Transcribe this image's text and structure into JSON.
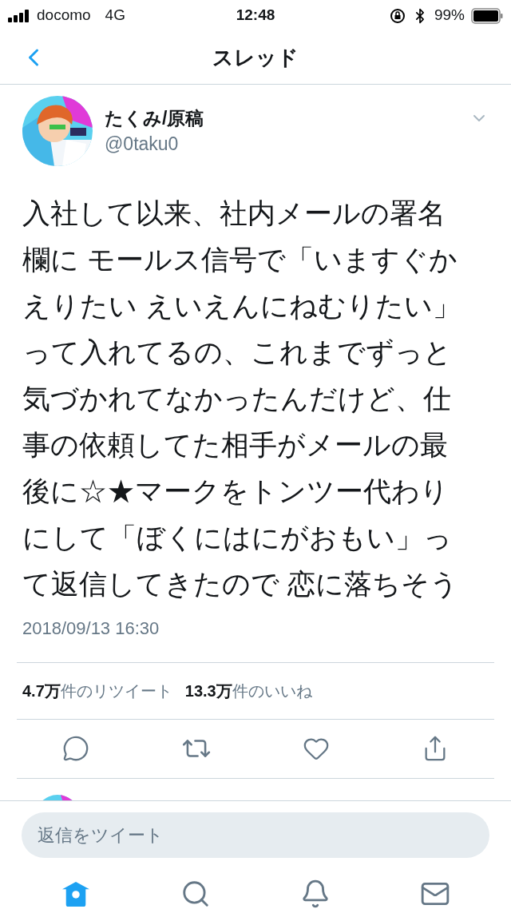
{
  "status_bar": {
    "carrier": "docomo",
    "network": "4G",
    "time": "12:48",
    "battery": "99%"
  },
  "header": {
    "title": "スレッド"
  },
  "tweet": {
    "name": "たくみ/原稿",
    "handle": "@0taku0",
    "text": "入社して以来、社内メールの署名欄に モールス信号で「いますぐかえりたい えいえんにねむりたい」って入れてるの、これまでずっと気づかれてなかったんだけど、仕事の依頼してた相手がメールの最後に☆★マークをトンツー代わりにして「ぼくにはにがおもい」って返信してきたので 恋に落ちそう",
    "timestamp": "2018/09/13 16:30",
    "stats": [
      {
        "count": "4.7万",
        "label": "件のリツイート"
      },
      {
        "count": "13.3万",
        "label": "件のいいね"
      }
    ]
  },
  "reply_field": {
    "placeholder": "返信をツイート"
  },
  "tab_bar": [
    {
      "kind": "home",
      "selected": true
    },
    {
      "kind": "search",
      "selected": false
    },
    {
      "kind": "notifications",
      "selected": false
    },
    {
      "kind": "messages",
      "selected": false
    }
  ]
}
